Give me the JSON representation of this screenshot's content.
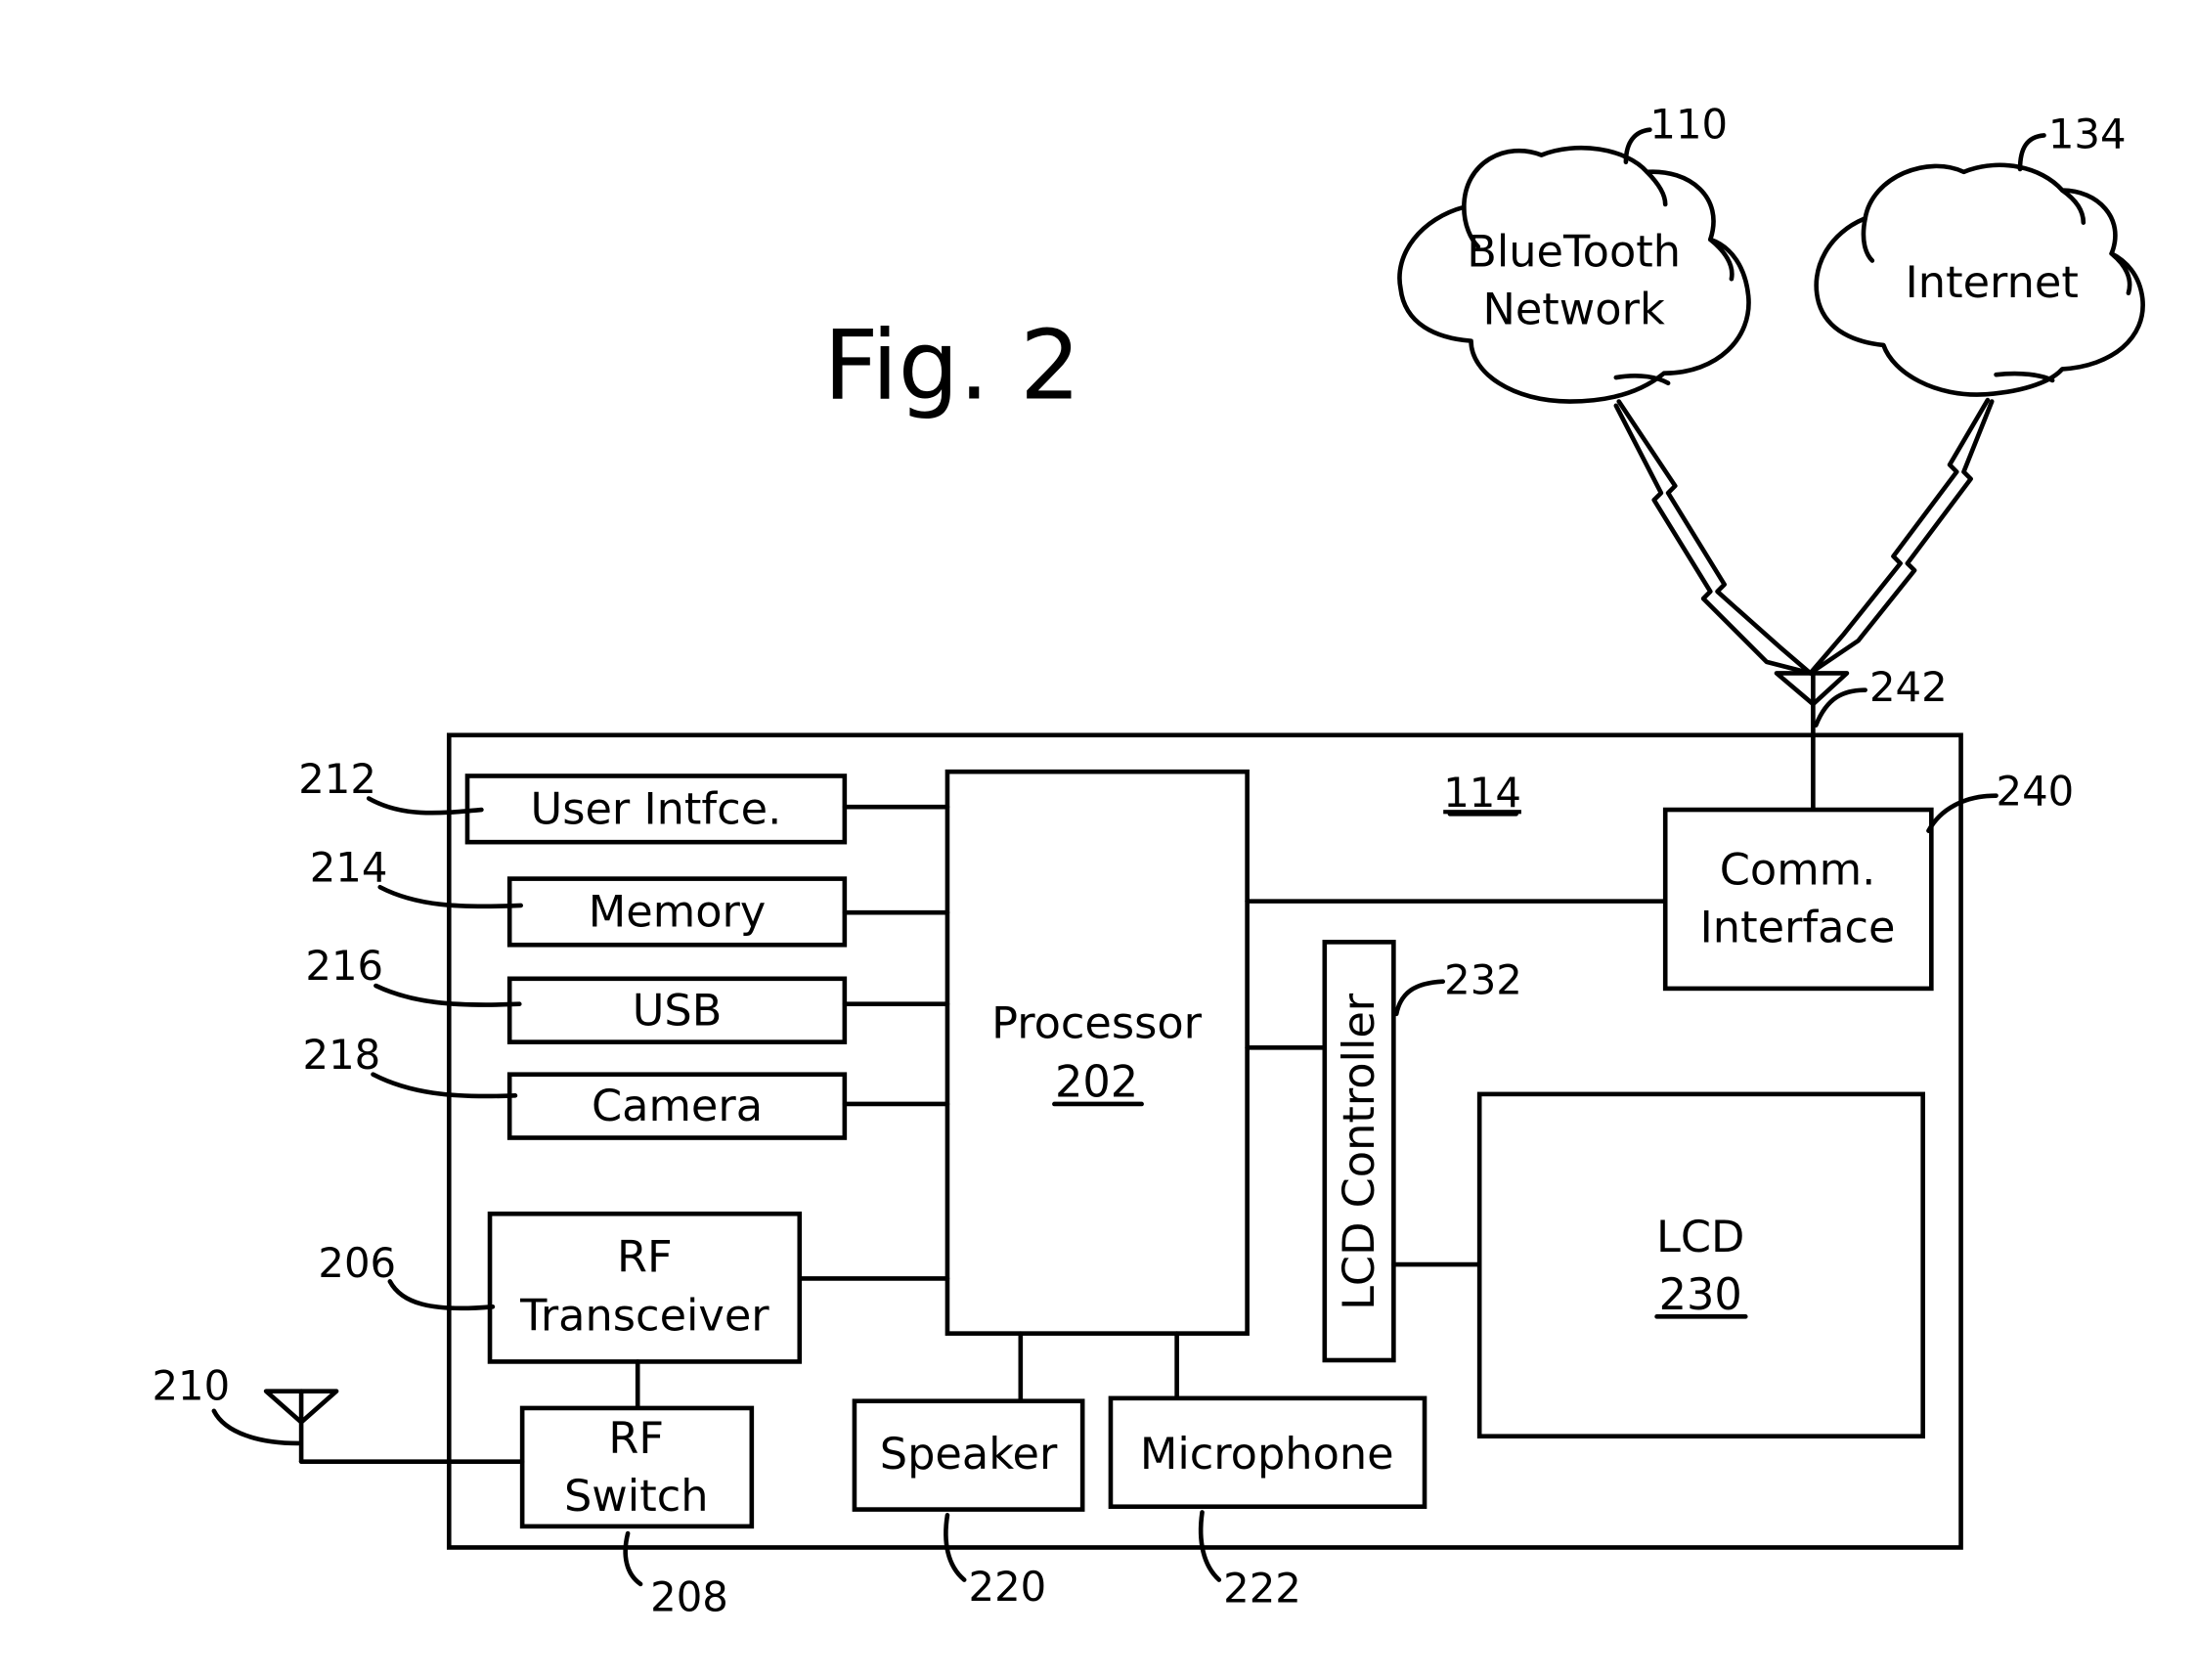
{
  "figure": {
    "title": "Fig. 2",
    "device_ref": "114"
  },
  "networks": [
    {
      "id": "bluetooth",
      "lines": [
        "BlueTooth",
        "Network"
      ],
      "ref": "110"
    },
    {
      "id": "internet",
      "lines": [
        "Internet"
      ],
      "ref": "134"
    }
  ],
  "antenna_top": {
    "ref": "242"
  },
  "antenna_left": {
    "ref": "210"
  },
  "blocks": {
    "user_interface": {
      "label": "User Intfce.",
      "ref": "212"
    },
    "memory": {
      "label": "Memory",
      "ref": "214"
    },
    "usb": {
      "label": "USB",
      "ref": "216"
    },
    "camera": {
      "label": "Camera",
      "ref": "218"
    },
    "processor": {
      "label": "Processor",
      "number": "202"
    },
    "comm_interface": {
      "lines": [
        "Comm.",
        "Interface"
      ],
      "ref": "240"
    },
    "lcd_controller": {
      "label": "LCD Controller",
      "ref": "232"
    },
    "lcd": {
      "label": "LCD",
      "number": "230"
    },
    "rf_transceiver": {
      "lines": [
        "RF",
        "Transceiver"
      ],
      "ref": "206"
    },
    "rf_switch": {
      "lines": [
        "RF",
        "Switch"
      ],
      "ref": "208"
    },
    "speaker": {
      "label": "Speaker",
      "ref": "220"
    },
    "microphone": {
      "label": "Microphone",
      "ref": "222"
    }
  }
}
